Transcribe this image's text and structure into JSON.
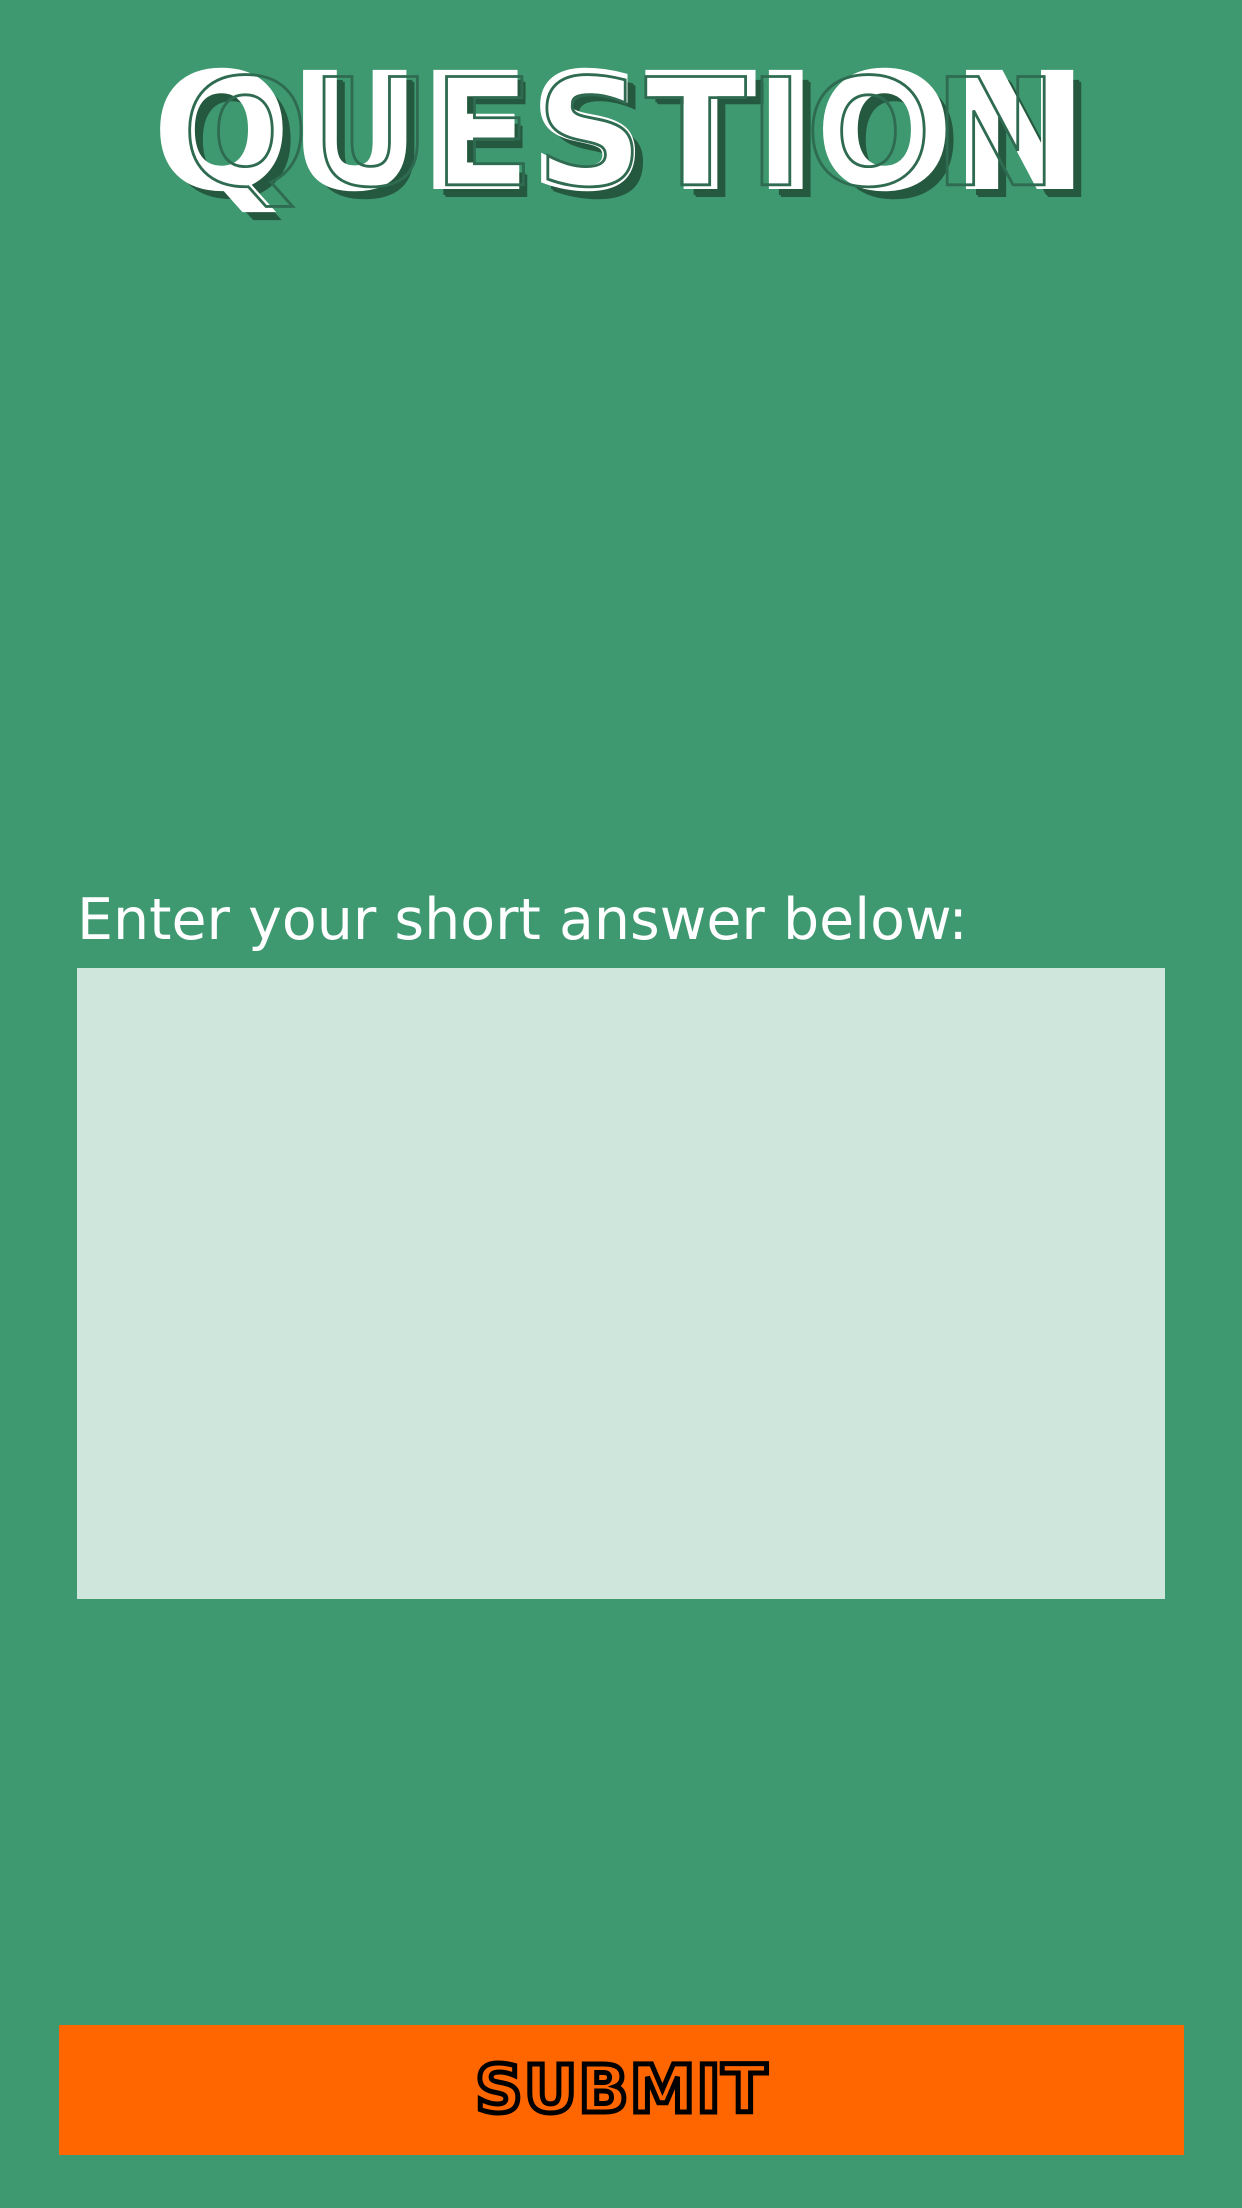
{
  "header": {
    "title": "QUESTION"
  },
  "answer": {
    "label": "Enter your short answer below:",
    "value": "",
    "placeholder": ""
  },
  "submit": {
    "label": "SUBMIT"
  },
  "colors": {
    "background": "#3f9970",
    "title_text": "#ffffff",
    "title_shadow": "#25593f",
    "answer_field": "#cfe6dc",
    "submit_button": "#ff6600",
    "submit_text_outline": "#000000"
  }
}
